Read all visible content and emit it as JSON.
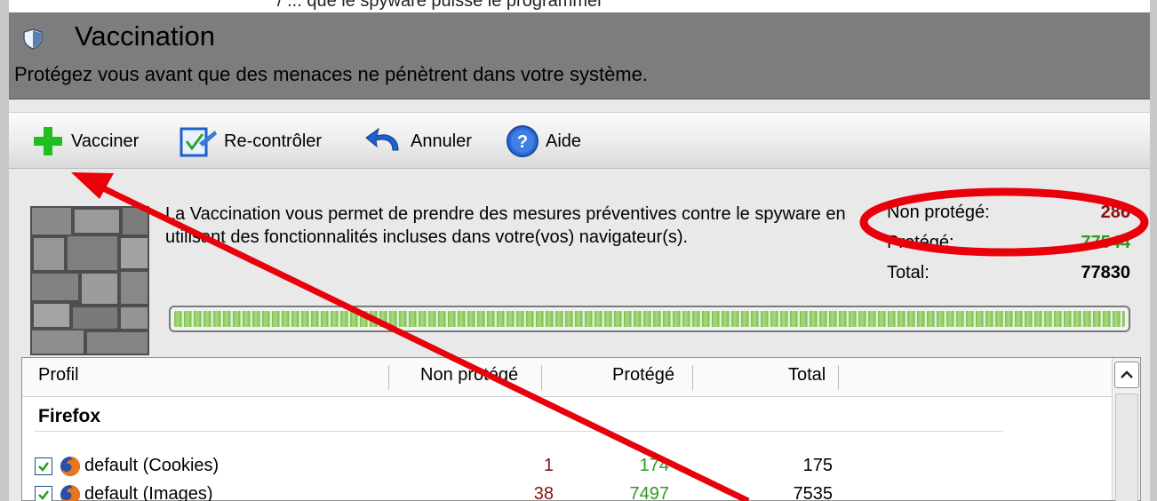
{
  "top_fragment": "/ ... que le spyware puisse le programmer",
  "header": {
    "title": "Vaccination",
    "subtitle": "Protégez vous avant que des menaces ne pénètrent dans votre système."
  },
  "toolbar": {
    "vaccinate_label": "Vacciner",
    "recheck_label": "Re-contrôler",
    "undo_label": "Annuler",
    "help_label": "Aide"
  },
  "description": "La Vaccination vous permet de prendre des mesures préventives contre le spyware en utilisant des fonctionnalités incluses dans votre(vos) navigateur(s).",
  "stats": {
    "unprotected_label": "Non protégé:",
    "unprotected_value": "286",
    "protected_label": "Protégé:",
    "protected_value": "77544",
    "total_label": "Total:",
    "total_value": "77830"
  },
  "progress": {
    "fraction": 1.0
  },
  "table": {
    "headers": {
      "profile": "Profil",
      "unprotected": "Non protégé",
      "protected": "Protégé",
      "total": "Total"
    },
    "group": "Firefox",
    "rows": [
      {
        "name": "default (Cookies)",
        "unprotected": "1",
        "protected": "174",
        "total": "175"
      },
      {
        "name": "default (Images)",
        "unprotected": "38",
        "protected": "7497",
        "total": "7535"
      }
    ]
  },
  "colors": {
    "unprotected": "#8b1010",
    "protected": "#2e9a22",
    "annotation": "#e8000b",
    "header_bg": "#7d7d7d"
  },
  "icons": {
    "title": "shield-icon",
    "vaccinate": "plus-icon",
    "recheck": "recheck-icon",
    "undo": "undo-arrow-icon",
    "help": "help-icon",
    "row": "firefox-icon"
  }
}
